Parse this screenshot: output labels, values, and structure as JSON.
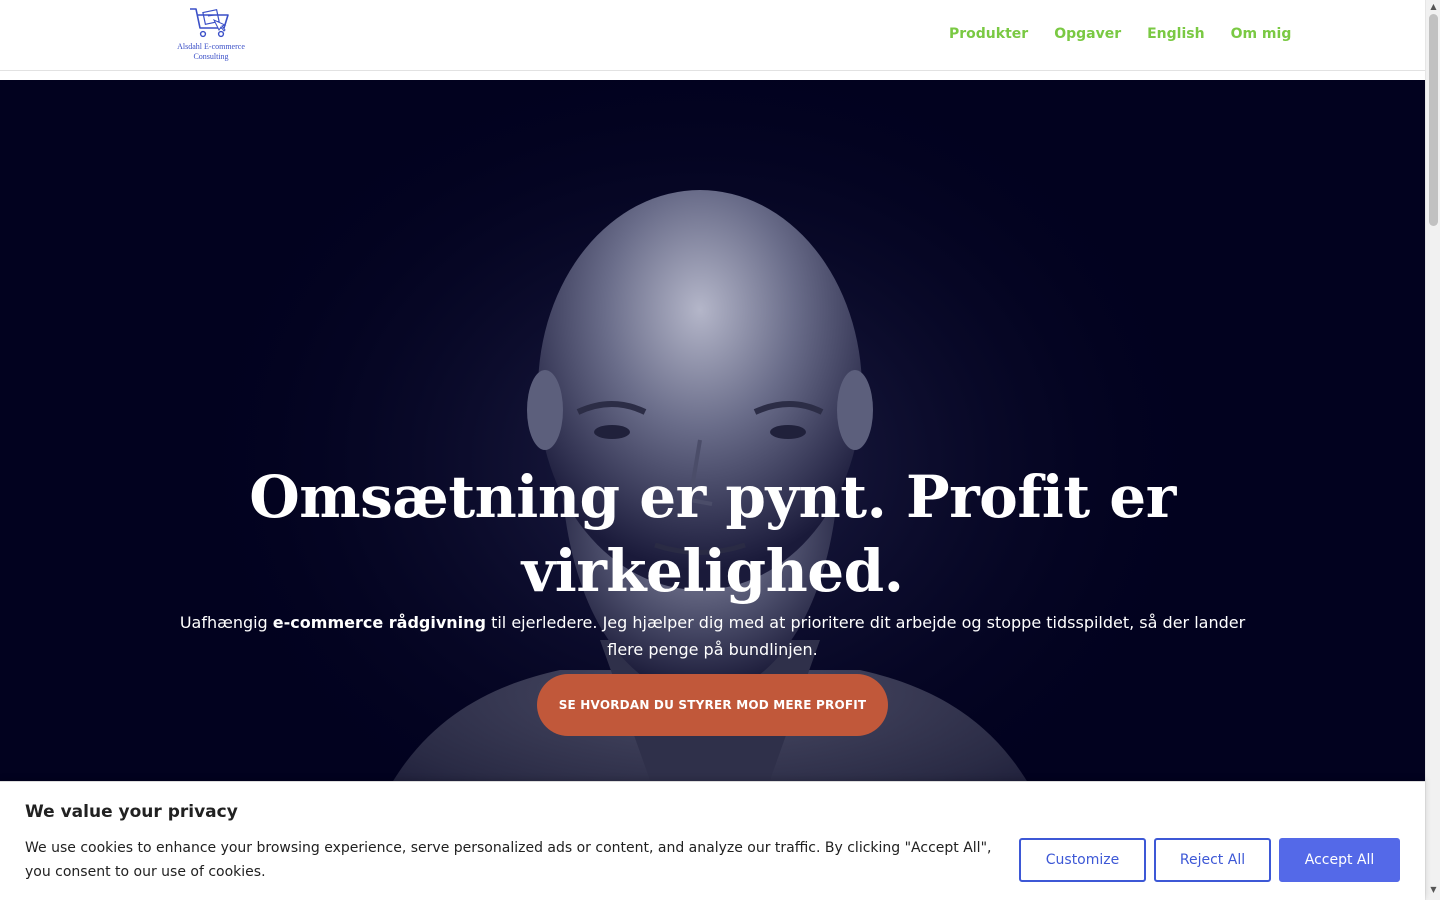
{
  "header": {
    "logo_text": "Alsdahl E-commerce Consulting",
    "nav": [
      "Produkter",
      "Opgaver",
      "English",
      "Om mig"
    ]
  },
  "hero": {
    "title": "Omsætning er pynt. Profit er virkelighed.",
    "subtitle_before": "Uafhængig ",
    "subtitle_bold": "e-commerce rådgivning",
    "subtitle_after": " til ejerledere. Jeg hjælper dig med at prioritere dit arbejde og stoppe tidsspildet, så der lander flere penge på bundlinjen.",
    "cta_label": "SE HVORDAN DU STYRER MOD MERE PROFIT"
  },
  "cookie_banner": {
    "title": "We value your privacy",
    "text": "We use cookies to enhance your browsing experience, serve personalized ads or content, and analyze our traffic. By clicking \"Accept All\", you consent to our use of cookies.",
    "customize_label": "Customize",
    "reject_label": "Reject All",
    "accept_label": "Accept All"
  },
  "colors": {
    "nav_link": "#7ac943",
    "hero_bg": "#02021f",
    "cta_bg": "#c1583a",
    "cookie_button": "#3d58d6",
    "accept_bg": "#5469e8"
  },
  "icons": {
    "logo": "shopping-cart-icon"
  }
}
